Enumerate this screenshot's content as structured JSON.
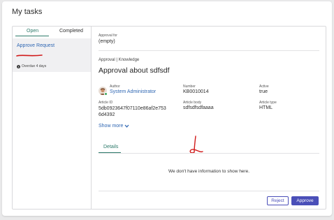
{
  "page": {
    "title": "My tasks"
  },
  "task_tabs": [
    {
      "label": "Open",
      "active": true
    },
    {
      "label": "Completed",
      "active": false
    }
  ],
  "task_list": [
    {
      "title": "Approve Request",
      "status": "Overdue 4 days",
      "status_icon": "exclamation-icon"
    }
  ],
  "detail": {
    "approval_for_label": "Approval for",
    "approval_for_value": "(empty)",
    "breadcrumb": "Approval | Knowledge",
    "title": "Approval about sdfsdf",
    "fields": {
      "author_label": "Author",
      "author_value": "System Administrator",
      "number_label": "Number",
      "number_value": "KB0010014",
      "active_label": "Active",
      "active_value": "true",
      "article_id_label": "Article ID",
      "article_id_value": "5db0923647f07110e86af2e753\n6d4392",
      "article_body_label": "Article body",
      "article_body_value": "sdfsdfsdfaaaa",
      "article_type_label": "Article type",
      "article_type_value": "HTML"
    },
    "show_more": "Show more",
    "tabs": [
      {
        "label": "Details",
        "active": true
      }
    ],
    "empty_message": "We don't have information to show here."
  },
  "actions": {
    "reject": "Reject",
    "approve": "Approve"
  },
  "colors": {
    "accent_teal": "#2d7a6a",
    "link_blue": "#2f67b3",
    "button_indigo": "#4a4fb8",
    "annotation_red": "#d11a1a"
  }
}
